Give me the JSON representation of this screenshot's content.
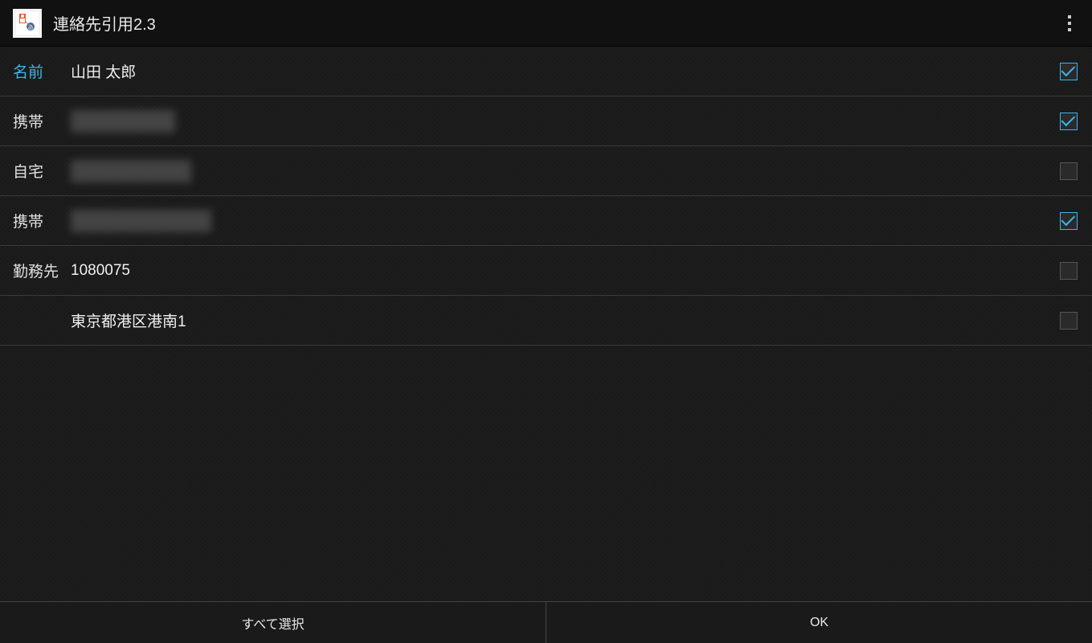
{
  "header": {
    "title": "連絡先引用2.3"
  },
  "rows": [
    {
      "label": "名前",
      "value": "山田 太郎",
      "checked": true,
      "highlight": true,
      "redacted": false
    },
    {
      "label": "携帯",
      "value": "",
      "checked": true,
      "highlight": false,
      "redacted": true
    },
    {
      "label": "自宅",
      "value": "",
      "checked": false,
      "highlight": false,
      "redacted": true
    },
    {
      "label": "携帯",
      "value": "",
      "checked": true,
      "highlight": false,
      "redacted": true
    },
    {
      "label": "勤務先",
      "value": "1080075",
      "checked": false,
      "highlight": false,
      "redacted": false
    },
    {
      "label": "",
      "value": "東京都港区港南1",
      "checked": false,
      "highlight": false,
      "redacted": false
    }
  ],
  "buttons": {
    "select_all": "すべて選択",
    "ok": "OK"
  }
}
